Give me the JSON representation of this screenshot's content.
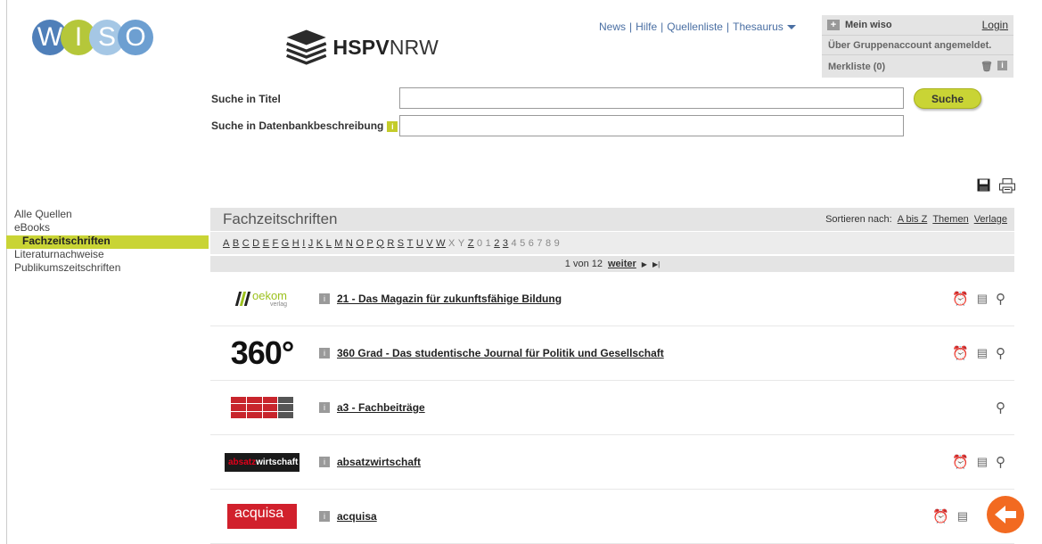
{
  "logo": {
    "letters": [
      "W",
      "I",
      "S",
      "O"
    ]
  },
  "partner_logo": {
    "bold": "HSPV",
    "light": "NRW"
  },
  "topnav": {
    "news": "News",
    "hilfe": "Hilfe",
    "quellenliste": "Quellenliste",
    "thesaurus": "Thesaurus",
    "separator": "|"
  },
  "meinwiso": {
    "title": "Mein wiso",
    "login": "Login",
    "status": "Über Gruppenaccount angemeldet.",
    "merkliste": "Merkliste (0)"
  },
  "search": {
    "title_label": "Suche in Titel",
    "desc_label": "Suche in Datenbankbeschreibung",
    "title_value": "",
    "desc_value": "",
    "button": "Suche"
  },
  "sidebar": {
    "items": [
      {
        "label": "Alle Quellen",
        "active": false
      },
      {
        "label": "eBooks",
        "active": false
      },
      {
        "label": "Fachzeitschriften",
        "active": true
      },
      {
        "label": "Literaturnachweise",
        "active": false
      },
      {
        "label": "Publikumszeitschriften",
        "active": false
      }
    ]
  },
  "list": {
    "heading": "Fachzeitschriften",
    "sort_label": "Sortieren nach:",
    "sort_options": [
      "A bis Z",
      "Themen",
      "Verlage"
    ],
    "alphabet": [
      {
        "c": "A",
        "link": true
      },
      {
        "c": "B",
        "link": true
      },
      {
        "c": "C",
        "link": true
      },
      {
        "c": "D",
        "link": true
      },
      {
        "c": "E",
        "link": true
      },
      {
        "c": "F",
        "link": true
      },
      {
        "c": "G",
        "link": true
      },
      {
        "c": "H",
        "link": true
      },
      {
        "c": "I",
        "link": true
      },
      {
        "c": "J",
        "link": true
      },
      {
        "c": "K",
        "link": true
      },
      {
        "c": "L",
        "link": true
      },
      {
        "c": "M",
        "link": true
      },
      {
        "c": "N",
        "link": true
      },
      {
        "c": "O",
        "link": true
      },
      {
        "c": "P",
        "link": true
      },
      {
        "c": "Q",
        "link": true
      },
      {
        "c": "R",
        "link": true
      },
      {
        "c": "S",
        "link": true
      },
      {
        "c": "T",
        "link": true
      },
      {
        "c": "U",
        "link": true
      },
      {
        "c": "V",
        "link": true
      },
      {
        "c": "W",
        "link": true
      },
      {
        "c": "X",
        "link": false
      },
      {
        "c": "Y",
        "link": false
      },
      {
        "c": "Z",
        "link": true
      },
      {
        "c": "0",
        "link": false
      },
      {
        "c": "1",
        "link": false
      },
      {
        "c": "2",
        "link": true
      },
      {
        "c": "3",
        "link": true
      },
      {
        "c": "4",
        "link": false
      },
      {
        "c": "5",
        "link": false
      },
      {
        "c": "6",
        "link": false
      },
      {
        "c": "7",
        "link": false
      },
      {
        "c": "8",
        "link": false
      },
      {
        "c": "9",
        "link": false
      }
    ],
    "pager": {
      "text": "1 von 12",
      "next": "weiter"
    },
    "rows": [
      {
        "logo": "oekom",
        "logo_text": "oekom",
        "logo_sub": "verlag",
        "title": "21 - Das Magazin für zukunftsfähige Bildung",
        "alarm": true,
        "doc": true,
        "search": true
      },
      {
        "logo": "360",
        "logo_text": "360°",
        "title": "360 Grad - Das studentische Journal für Politik und Gesellschaft",
        "alarm": true,
        "doc": true,
        "search": true
      },
      {
        "logo": "a3",
        "title": "a3 - Fachbeiträge",
        "alarm": false,
        "doc": false,
        "search": true
      },
      {
        "logo": "absatz",
        "logo_text_a": "absatz",
        "logo_text_b": "wirtschaft",
        "title": "absatzwirtschaft",
        "alarm": true,
        "doc": true,
        "search": true
      },
      {
        "logo": "acquisa",
        "logo_text": "acquisa",
        "title": "acquisa",
        "alarm": true,
        "doc": true,
        "search": false
      }
    ]
  },
  "colors": {
    "accent": "#c9d435",
    "header_gray": "#e4e4e4",
    "link_blue": "#4a6fa3",
    "orange": "#f26a21"
  },
  "icons": {
    "save": "save-icon",
    "print": "print-icon",
    "trash": "trash-icon",
    "info": "info-icon",
    "alarm": "alarm-clock-icon",
    "doc": "document-icon",
    "search": "magnifier-icon"
  }
}
